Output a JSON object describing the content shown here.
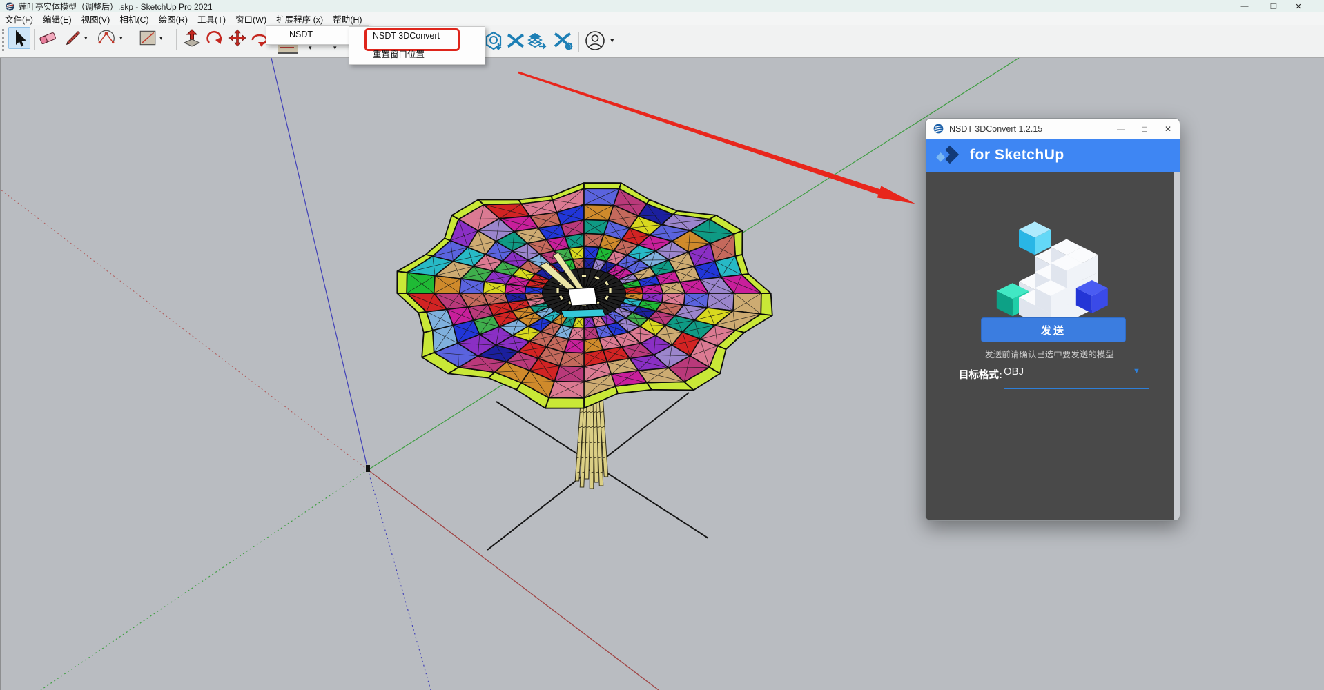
{
  "app": {
    "title": "莲叶亭实体模型（调整后）.skp - SketchUp Pro 2021",
    "controls": {
      "minimize": "—",
      "restore": "❐",
      "close": "✕"
    }
  },
  "menu_bar": {
    "items": [
      "文件(F)",
      "编辑(E)",
      "视图(V)",
      "相机(C)",
      "绘图(R)",
      "工具(T)",
      "窗口(W)",
      "扩展程序 (x)",
      "帮助(H)"
    ]
  },
  "toolbar": {
    "tools": [
      "select",
      "eraser",
      "line",
      "arc",
      "rectangle",
      "push-pull",
      "follow-me",
      "move",
      "rotate"
    ],
    "nsdt_tools": [
      "nsdt-import",
      "nsdt-convert",
      "nsdt-export",
      "nsdt-settings"
    ],
    "signin": "sign-in"
  },
  "extensions_menu": {
    "items": [
      {
        "label": "NSDT",
        "has_submenu": true
      }
    ]
  },
  "submenu": {
    "items": [
      {
        "label": "NSDT 3DConvert",
        "highlighted": true
      },
      {
        "label": "重置窗口位置",
        "highlighted": false
      }
    ]
  },
  "plugin": {
    "title": "NSDT 3DConvert 1.2.15",
    "controls": {
      "minimize": "—",
      "maximize": "□",
      "close": "✕"
    },
    "header": "for SketchUp",
    "send_label": "发送",
    "hint": "发送前请确认已选中要发送的模型",
    "format_label": "目标格式:",
    "format_value": "OBJ"
  },
  "colors": {
    "header_blue": "#3e86f3",
    "send_button": "#3b7de0",
    "highlight_red": "#de251b",
    "annotation_arrow": "#e8261c",
    "axis_green": "#3f9e42",
    "axis_red": "#a04545",
    "axis_blue": "#4040b8",
    "viewport_bg": "#b9bcc1",
    "nsdt_icon_blue": "#1d7fb5"
  },
  "model": {
    "seed": 11,
    "rim": "#c9e837",
    "trunk": "#dbcf85",
    "palette": [
      "#2136d8",
      "#c81f9b",
      "#d22323",
      "#1fba35",
      "#27b9c6",
      "#0f9a84",
      "#8a2fc4",
      "#5a63de",
      "#cf8a2b",
      "#cdab72",
      "#db7a92",
      "#c4695c",
      "#7fb0dd",
      "#9b85cc",
      "#1b1f9e",
      "#b9397a",
      "#3fae4c",
      "#d8d81f"
    ]
  }
}
